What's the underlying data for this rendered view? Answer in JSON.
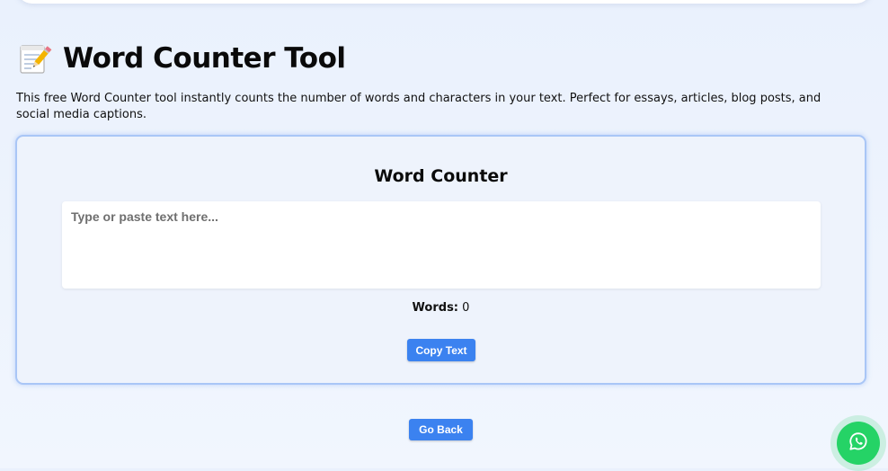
{
  "header": {
    "icon": "memo-icon",
    "title": "Word Counter Tool"
  },
  "intro": {
    "text": "This free Word Counter tool instantly counts the number of words and characters in your text. Perfect for essays, articles, blog posts, and social media captions."
  },
  "tool": {
    "title": "Word Counter",
    "input_placeholder": "Type or paste text here...",
    "input_value": "",
    "words_label": "Words:",
    "words_value": "0",
    "copy_label": "Copy Text"
  },
  "footer": {
    "back_label": "Go Back"
  },
  "floating": {
    "icon": "whatsapp-icon"
  },
  "colors": {
    "accent": "#3b82f0",
    "card_border": "#a9c6f6",
    "whatsapp": "#25d366"
  }
}
